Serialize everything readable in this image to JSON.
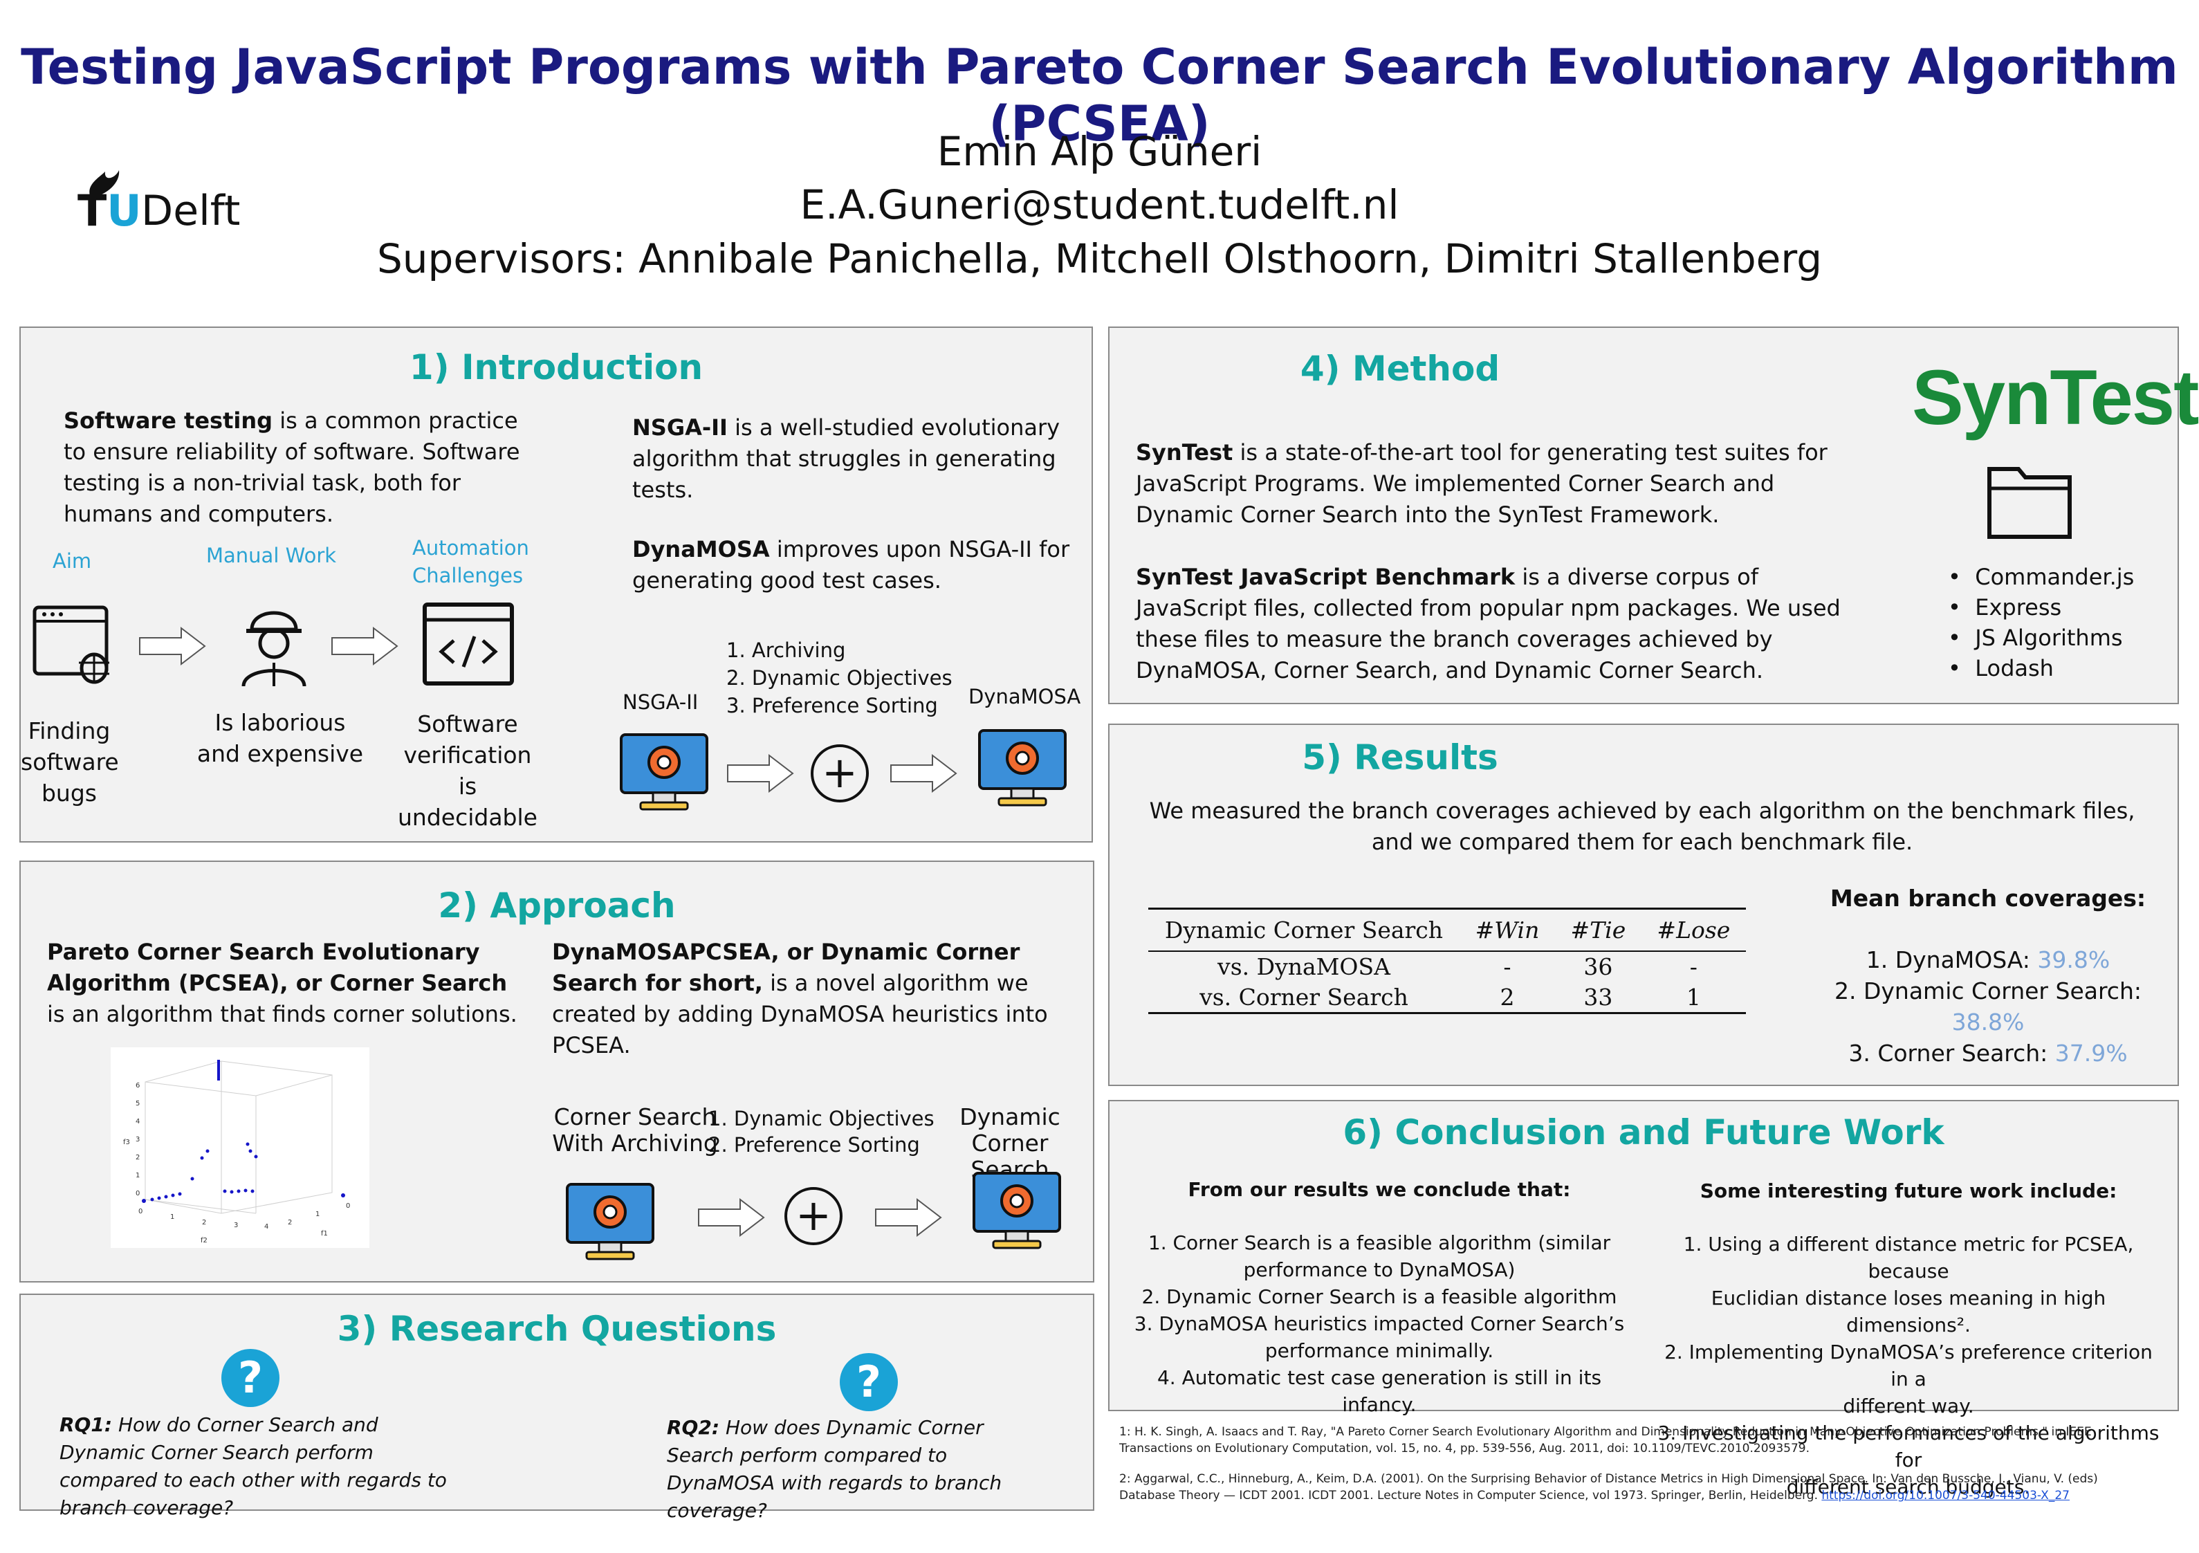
{
  "header": {
    "title": "Testing JavaScript Programs with Pareto Corner Search Evolutionary Algorithm (PCSEA)",
    "author": "Emin Alp Güneri",
    "email": "E.A.Guneri@student.tudelft.nl",
    "supervisors": "Supervisors: Annibale Panichella, Mitchell Olsthoorn, Dimitri Stallenberg",
    "logo_tu": "TU",
    "logo_delft": "Delft"
  },
  "intro": {
    "title": "1) Introduction",
    "p1_bold": "Software testing",
    "p1_rest": " is a common practice to ensure reliability of software. Software testing is a non-trivial task, both for humans and computers.",
    "p2_bold": "NSGA-II",
    "p2_rest": " is a well-studied evolutionary algorithm that struggles in generating tests.",
    "p3_bold": "DynaMOSA",
    "p3_rest": " improves upon NSGA-II for generating good test cases.",
    "label_aim": "Aim",
    "label_manual": "Manual Work",
    "label_auto1": "Automation",
    "label_auto2": "Challenges",
    "cap1": [
      "Finding",
      "software",
      "bugs"
    ],
    "cap2": [
      "Is laborious",
      "and expensive"
    ],
    "cap3": [
      "Software",
      "verification is",
      "undecidable"
    ],
    "steps": [
      "1.  Archiving",
      "2.  Dynamic Objectives",
      "3.  Preference Sorting"
    ],
    "nsga": "NSGA-II",
    "dynamosa": "DynaMOSA",
    "plus": "+"
  },
  "approach": {
    "title": "2) Approach",
    "p1_bold": "Pareto Corner Search Evolutionary Algorithm (PCSEA), or Corner Search",
    "p1_rest": " is an algorithm that finds corner solutions.",
    "p2_bold": "DynaMOSAPCSEA, or Dynamic Corner Search for short,",
    "p2_rest": " is a novel algorithm we created by adding DynaMOSA heuristics into PCSEA.",
    "left_label": [
      "Corner Search",
      "With Archiving"
    ],
    "steps": [
      "1.  Dynamic Objectives",
      "2.  Preference Sorting"
    ],
    "right_label": [
      "Dynamic",
      "Corner Search"
    ],
    "plus": "+",
    "plot_ticks_y": [
      "6",
      "5",
      "4",
      "3",
      "2",
      "1",
      "0"
    ],
    "plot_ticks_x": [
      "0",
      "1",
      "2",
      "3",
      "4",
      "2",
      "1",
      "0"
    ],
    "plot_labels": {
      "f1": "f1",
      "f2": "f2",
      "f3": "f3"
    }
  },
  "rq": {
    "title": "3) Research Questions",
    "icon": "?",
    "rq1_bold": "RQ1:",
    "rq1_rest": " How do Corner Search and Dynamic Corner Search perform compared to each other with regards to branch coverage?",
    "rq2_bold": "RQ2:",
    "rq2_rest": " How does Dynamic Corner Search perform compared to DynaMOSA with regards to branch coverage?"
  },
  "method": {
    "title": "4) Method",
    "p1_bold": "SynTest",
    "p1_rest": " is a state-of-the-art tool for generating test suites for JavaScript Programs. We implemented Corner Search and Dynamic Corner Search into the SynTest Framework.",
    "p2_bold": "SynTest JavaScript Benchmark",
    "p2_rest": " is a diverse corpus of JavaScript files, collected from popular npm packages. We used these files to measure the branch coverages achieved by DynaMOSA, Corner Search, and Dynamic Corner Search.",
    "logo": "SynTest",
    "bullets": [
      "Commander.js",
      "Express",
      "JS Algorithms",
      "Lodash"
    ]
  },
  "results": {
    "title": "5) Results",
    "intro": "We measured the branch coverages achieved by each algorithm on the benchmark files, and we compared them for each benchmark file.",
    "table": {
      "headers": [
        "Dynamic Corner Search",
        "#Win",
        "#Tie",
        "#Lose"
      ],
      "rows": [
        [
          "vs. DynaMOSA",
          "-",
          "36",
          "-"
        ],
        [
          "vs. Corner Search",
          "2",
          "33",
          "1"
        ]
      ]
    },
    "mean_title": "Mean branch coverages:",
    "mean": [
      {
        "label": "1. DynaMOSA: ",
        "value": "39.8%"
      },
      {
        "label": "2. Dynamic Corner Search: ",
        "value": "38.8%"
      },
      {
        "label": "3. Corner Search: ",
        "value": "37.9%"
      }
    ],
    "value_color": "#7ea6d8"
  },
  "conclusion": {
    "title": "6) Conclusion and Future Work",
    "left_title": "From our results we conclude that:",
    "left_items": [
      "1.  Corner Search is a feasible algorithm (similar",
      "performance to DynaMOSA)",
      "2.  Dynamic Corner Search is a feasible algorithm",
      "3.  DynaMOSA heuristics impacted Corner Search’s",
      "performance minimally.",
      "4.  Automatic test case generation is still in its infancy."
    ],
    "right_title": "Some interesting future work include:",
    "right_items": [
      "1.  Using a different distance metric for PCSEA, because",
      "Euclidian distance loses meaning in high dimensions².",
      "2.  Implementing DynaMOSA’s preference criterion in a",
      "different way.",
      "3.  Investigating the performances of the algorithms for",
      "different search budgets."
    ]
  },
  "references": {
    "r1": "1: H. K. Singh, A. Isaacs and T. Ray, \"A Pareto Corner Search Evolutionary Algorithm and Dimensionality Reduction in Many-Objective Optimization Problems,\" in IEEE Transactions on Evolutionary Computation, vol. 15, no. 4, pp. 539-556, Aug. 2011, doi: 10.1109/TEVC.2010.2093579.",
    "r2": "2: Aggarwal, C.C., Hinneburg, A., Keim, D.A. (2001). On the Surprising Behavior of Distance Metrics in High Dimensional Space. In: Van den Bussche, J., Vianu, V. (eds) Database Theory — ICDT 2001. ICDT 2001. Lecture Notes in Computer Science, vol 1973. Springer, Berlin, Heidelberg. ",
    "r2_link": "https://doi.org/10.1007/3-540-44503-X_27"
  },
  "colors": {
    "title": "#1a1a80",
    "section": "#13a6a1",
    "accent": "#2ba3d3",
    "syntest_green": "#1a8a3a"
  }
}
